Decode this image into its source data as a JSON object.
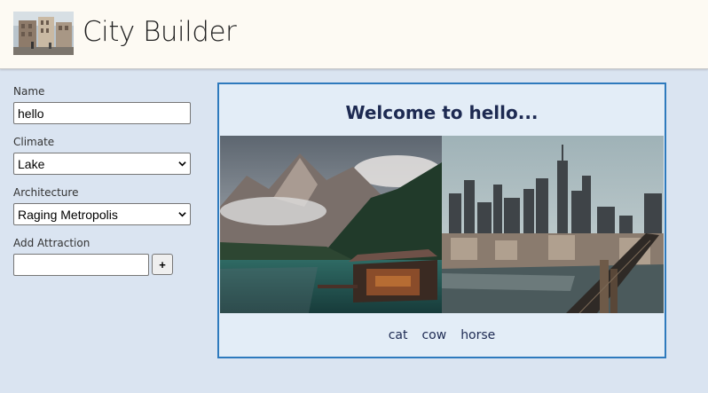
{
  "header": {
    "title": "City Builder",
    "logo": "town-street-photo-icon"
  },
  "form": {
    "name_label": "Name",
    "name_value": "hello",
    "climate_label": "Climate",
    "climate_value": "Lake",
    "architecture_label": "Architecture",
    "architecture_value": "Raging Metropolis",
    "attraction_label": "Add Attraction",
    "attraction_value": "",
    "add_button_label": "+"
  },
  "card": {
    "heading": "Welcome to hello...",
    "climate_image": "mountain-lake-photo",
    "architecture_image": "city-skyline-photo",
    "attractions": [
      "cat",
      "cow",
      "horse"
    ]
  },
  "colors": {
    "page_bg": "#dae4f1",
    "header_bg": "#fdfaf3",
    "card_border": "#2e7abd",
    "card_bg": "#e3edf7",
    "heading_text": "#1d2a52"
  }
}
